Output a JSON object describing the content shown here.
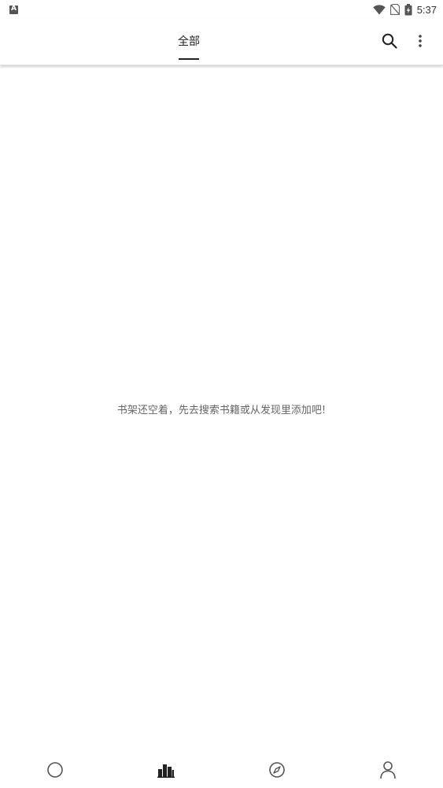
{
  "status_bar": {
    "time": "5:37",
    "icons": [
      "app-notification-icon",
      "wifi-icon",
      "no-sim-icon",
      "battery-charging-icon"
    ]
  },
  "app_bar": {
    "tabs": [
      {
        "label": "全部",
        "selected": true
      }
    ],
    "actions": [
      "search-icon",
      "more-vert-icon"
    ]
  },
  "bookshelf": {
    "empty_message": "书架还空着，先去搜索书籍或从发现里添加吧!"
  },
  "bottom_nav": {
    "items": [
      {
        "icon": "circle-icon",
        "selected": false
      },
      {
        "icon": "bookshelf-icon",
        "selected": true
      },
      {
        "icon": "compass-icon",
        "selected": false
      },
      {
        "icon": "person-icon",
        "selected": false
      }
    ]
  },
  "colors": {
    "text_primary": "#222222",
    "text_secondary": "#666666",
    "background": "#ffffff",
    "icon_inactive": "#555555"
  }
}
